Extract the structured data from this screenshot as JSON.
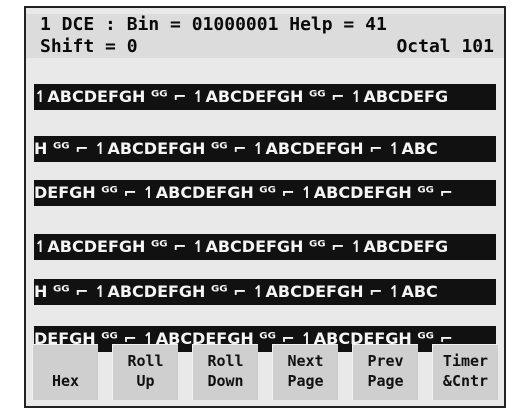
{
  "status": {
    "line1": "1 DCE : Bin = 01000001 Help = 41",
    "shift": "Shift = 0",
    "octal": "Octal 101"
  },
  "buffer_rows": [
    "↿ABCDEFGH ᴳᴳ ⌐ ↿ABCDEFGH ᴳᴳ ⌐ ↿ABCDEFG",
    "H ᴳᴳ ⌐ ↿ABCDEFGH ᴳᴳ ⌐ ↿ABCDEFGH ⌐ ↿ABC",
    "DEFGH ᴳᴳ ⌐ ↿ABCDEFGH ᴳᴳ ⌐ ↿ABCDEFGH ᴳᴳ ⌐",
    "↿ABCDEFGH ᴳᴳ ⌐ ↿ABCDEFGH ᴳᴳ ⌐ ↿ABCDEFG",
    "H ᴳᴳ ⌐ ↿ABCDEFGH ᴳᴳ ⌐ ↿ABCDEFGH ⌐ ↿ABC",
    "DEFGH ᴳᴳ ⌐ ↿ABCDEFGH ᴳᴳ ⌐ ↿ABCDEFGH ᴳᴳ ⌐"
  ],
  "softkeys": [
    {
      "label": "\nHex"
    },
    {
      "label": "Roll\nUp"
    },
    {
      "label": "Roll\nDown"
    },
    {
      "label": "Next\nPage"
    },
    {
      "label": "Prev\nPage"
    },
    {
      "label": "Timer\n&Cntr"
    }
  ]
}
